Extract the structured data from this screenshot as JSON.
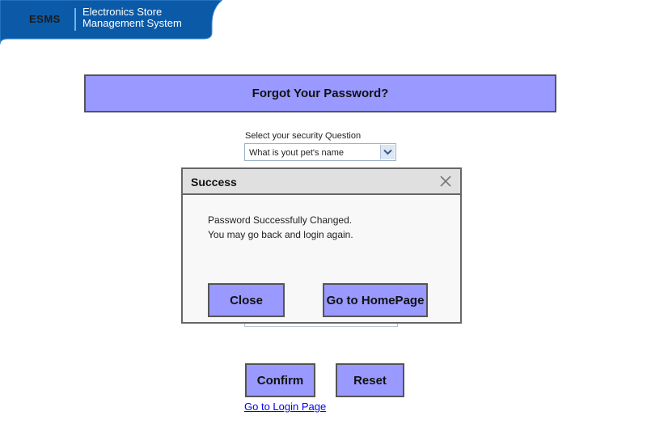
{
  "header": {
    "logo": "ESMS",
    "system_name_line1": "Electronics Store",
    "system_name_line2": "Management System",
    "brand_color": "#0b5aa8"
  },
  "page": {
    "title": "Forgot Your Password?",
    "security_question_label": "Select your security Question",
    "security_question_value": "What is yout pet's name",
    "confirm_label": "Confirm",
    "reset_label": "Reset",
    "login_link": "Go to Login Page",
    "button_color": "#9999ff"
  },
  "modal": {
    "title": "Success",
    "message_line1": "Password Successfully Changed.",
    "message_line2": "You may go back and login again.",
    "close_label": "Close",
    "home_label": "Go to HomePage"
  }
}
